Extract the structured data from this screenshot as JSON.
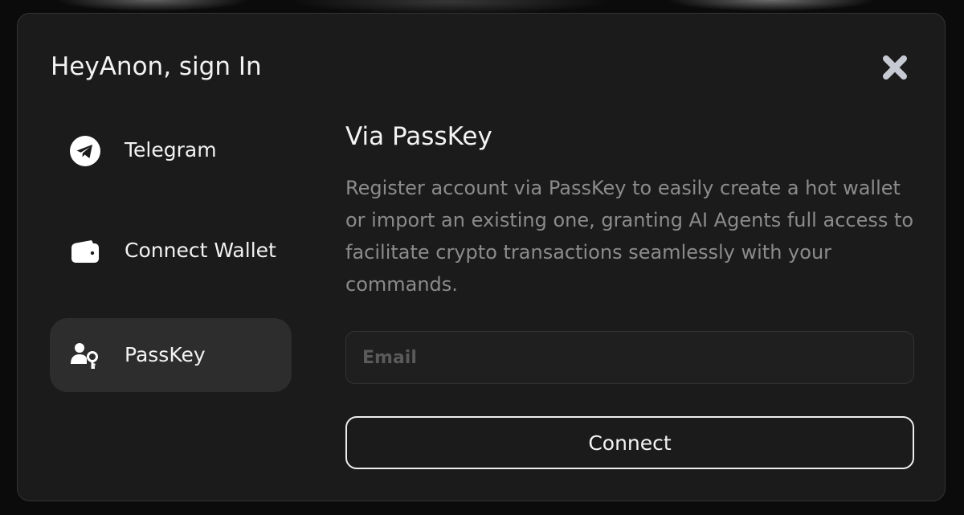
{
  "modal": {
    "title": "HeyAnon, sign In",
    "close_icon": "close-icon"
  },
  "nav": {
    "items": [
      {
        "label": "Telegram",
        "icon": "telegram-icon",
        "active": false
      },
      {
        "label": "Connect Wallet",
        "icon": "wallet-icon",
        "active": false
      },
      {
        "label": "PassKey",
        "icon": "passkey-icon",
        "active": true
      }
    ]
  },
  "passkey": {
    "title": "Via PassKey",
    "description": "Register account via PassKey to easily create a hot wallet or import an existing one, granting AI Agents full access to facilitate crypto transactions seamlessly with your commands.",
    "email": {
      "value": "",
      "placeholder": "Email"
    },
    "connect_label": "Connect"
  },
  "colors": {
    "modal_background": "#1b1b1b",
    "active_item_background": "#2d2d2d",
    "description_text": "#8b8b8b",
    "close_icon": "#c8cad3"
  }
}
